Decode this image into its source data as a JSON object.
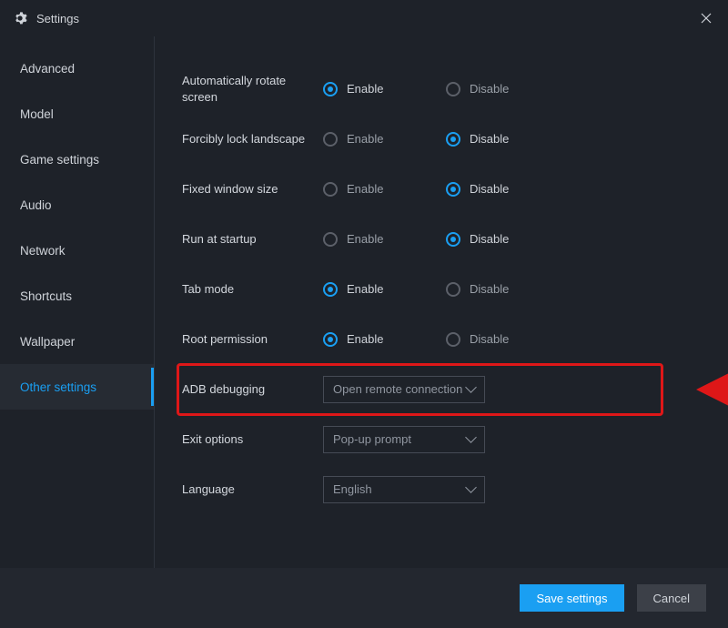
{
  "title": "Settings",
  "sidebar": {
    "items": [
      {
        "label": "Advanced",
        "name": "sidebar-advanced"
      },
      {
        "label": "Model",
        "name": "sidebar-model"
      },
      {
        "label": "Game settings",
        "name": "sidebar-game-settings"
      },
      {
        "label": "Audio",
        "name": "sidebar-audio"
      },
      {
        "label": "Network",
        "name": "sidebar-network"
      },
      {
        "label": "Shortcuts",
        "name": "sidebar-shortcuts"
      },
      {
        "label": "Wallpaper",
        "name": "sidebar-wallpaper"
      },
      {
        "label": "Other settings",
        "name": "sidebar-other-settings"
      }
    ],
    "active_index": 7
  },
  "labels": {
    "enable": "Enable",
    "disable": "Disable"
  },
  "settings": [
    {
      "label": "Automatically rotate screen",
      "type": "radio",
      "value": "enable"
    },
    {
      "label": "Forcibly lock landscape",
      "type": "radio",
      "value": "disable"
    },
    {
      "label": "Fixed window size",
      "type": "radio",
      "value": "disable"
    },
    {
      "label": "Run at startup",
      "type": "radio",
      "value": "disable"
    },
    {
      "label": "Tab mode",
      "type": "radio",
      "value": "enable"
    },
    {
      "label": "Root permission",
      "type": "radio",
      "value": "enable"
    },
    {
      "label": "ADB debugging",
      "type": "dropdown",
      "value": "Open remote connection"
    },
    {
      "label": "Exit options",
      "type": "dropdown",
      "value": "Pop-up prompt"
    },
    {
      "label": "Language",
      "type": "dropdown",
      "value": "English"
    }
  ],
  "footer": {
    "save_label": "Save settings",
    "cancel_label": "Cancel"
  },
  "annotation": {
    "highlight_index": 6,
    "arrow_color": "#de1718"
  }
}
